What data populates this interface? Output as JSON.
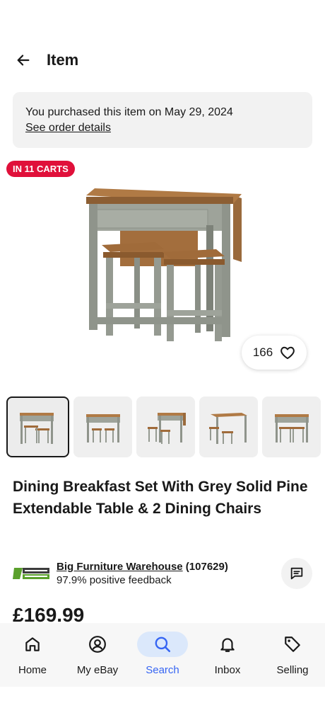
{
  "header": {
    "title": "Item"
  },
  "purchase": {
    "message": "You purchased this item on May 29, 2024",
    "link": "See order details"
  },
  "badge": {
    "label": "IN 11 CARTS"
  },
  "watch": {
    "count": "166"
  },
  "gallery": {
    "thumbnail_count": 5,
    "selected_index": 0
  },
  "item": {
    "title": "Dining Breakfast Set With Grey Solid Pine Extendable Table & 2 Dining Chairs",
    "price": "£169.99"
  },
  "seller": {
    "name": "Big Furniture Warehouse",
    "score": "(107629)",
    "feedback": "97.9% positive feedback",
    "logo_text": "BIG FURNITURE WAREHOUSE"
  },
  "nav": {
    "home": "Home",
    "my_ebay": "My eBay",
    "search": "Search",
    "inbox": "Inbox",
    "selling": "Selling"
  },
  "colors": {
    "badge_red": "#e0103a",
    "active_blue": "#3665f3",
    "active_bg": "#dbe8fb"
  }
}
